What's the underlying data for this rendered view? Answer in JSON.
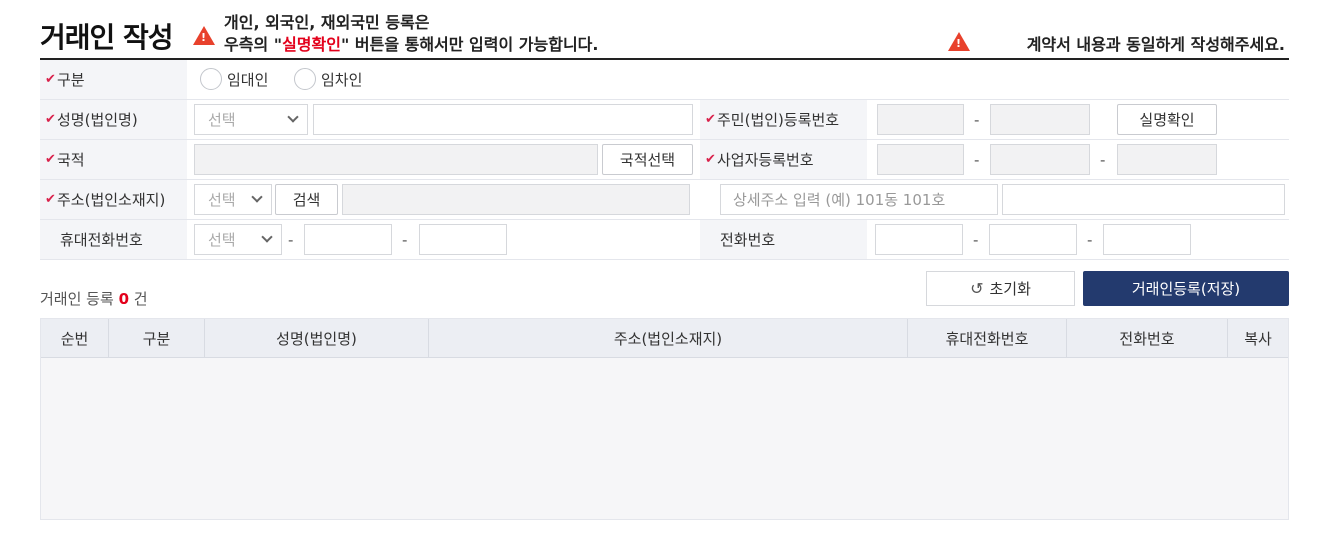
{
  "header": {
    "title": "거래인 작성",
    "notice_line1": "개인, 외국인, 재외국민 등록은",
    "notice_line2_prefix": "우측의 \"",
    "notice_highlight": "실명확인",
    "notice_line2_suffix": "\" 버튼을 통해서만 입력이 가능합니다.",
    "right_notice": "계약서 내용과 동일하게 작성해주세요."
  },
  "form": {
    "type_label": "구분",
    "radio_lessor": "임대인",
    "radio_lessee": "임차인",
    "name_label": "성명(법인명)",
    "name_select": "선택",
    "id_label": "주민(법인)등록번호",
    "verify_button": "실명확인",
    "nationality_label": "국적",
    "nationality_button": "국적선택",
    "bizno_label": "사업자등록번호",
    "address_label": "주소(법인소재지)",
    "address_select": "선택",
    "search_button": "검색",
    "address_detail_placeholder": "상세주소 입력 (예) 101동 101호",
    "mobile_label": "휴대전화번호",
    "mobile_select": "선택",
    "phone_label": "전화번호",
    "dash": "-"
  },
  "actions": {
    "count_prefix": "거래인 등록",
    "count_value": "0",
    "count_suffix": "건",
    "reset_button": "초기화",
    "save_button": "거래인등록(저장)"
  },
  "table": {
    "columns": [
      "순번",
      "구분",
      "성명(법인명)",
      "주소(법인소재지)",
      "휴대전화번호",
      "전화번호",
      "복사"
    ]
  },
  "colors": {
    "accent_red": "#e3001b",
    "navy_button": "#233a6e",
    "warning_icon": "#e8412c"
  }
}
